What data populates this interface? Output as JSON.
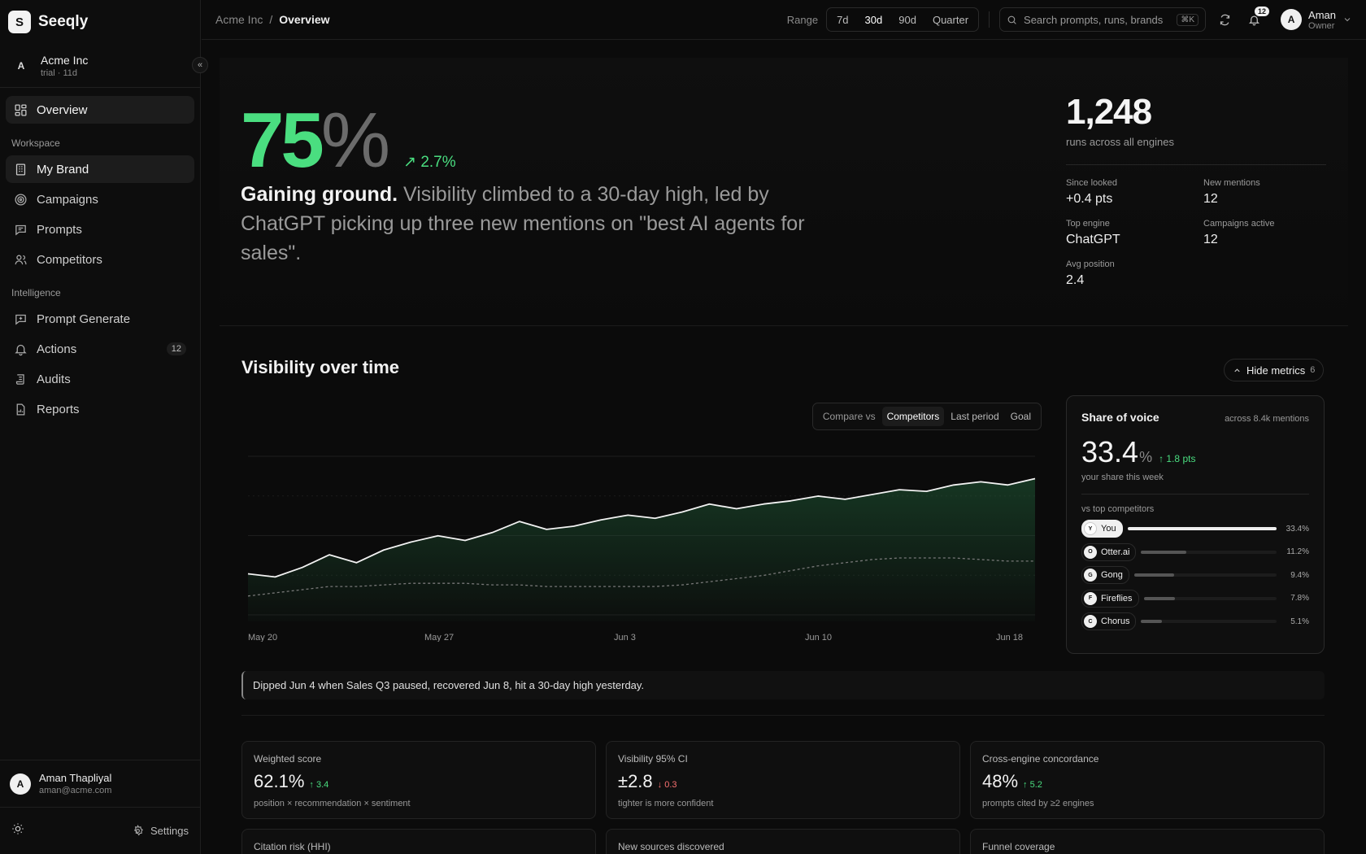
{
  "app": {
    "logo_letter": "S",
    "name": "Seeqly"
  },
  "org": {
    "avatar": "A",
    "name": "Acme Inc",
    "sub": "trial · 11d",
    "collapse_icon": "«"
  },
  "nav": {
    "overview": "Overview",
    "workspace_label": "Workspace",
    "workspace": [
      "My Brand",
      "Campaigns",
      "Prompts",
      "Competitors"
    ],
    "intelligence_label": "Intelligence",
    "intelligence": [
      "Prompt Generate",
      "Actions",
      "Audits",
      "Reports"
    ],
    "actions_badge": "12"
  },
  "user": {
    "avatar": "A",
    "name": "Aman Thapliyal",
    "email": "aman@acme.com"
  },
  "footer": {
    "settings": "Settings"
  },
  "topbar": {
    "crumb_org": "Acme Inc",
    "crumb_sep": "/",
    "crumb_page": "Overview",
    "range_label": "Range",
    "ranges": [
      "7d",
      "30d",
      "90d",
      "Quarter"
    ],
    "active_range": "30d",
    "search_placeholder": "Search prompts, runs, brands",
    "search_kbd": "⌘K",
    "notifications": "12",
    "me_avatar": "A",
    "me_name": "Aman",
    "me_role": "Owner"
  },
  "hero": {
    "score": "75",
    "score_unit": "%",
    "delta": "↗ 2.7%",
    "headline": "Gaining ground.",
    "summary": " Visibility climbed to a 30-day high, led by ChatGPT picking up three new mentions on \"best AI agents for sales\".",
    "runs": "1,248",
    "runs_sub": "runs across all engines",
    "stats": [
      {
        "label": "Since looked",
        "value": "+0.4 pts"
      },
      {
        "label": "New mentions",
        "value": "12"
      },
      {
        "label": "Top engine",
        "value": "ChatGPT"
      },
      {
        "label": "Campaigns active",
        "value": "12"
      },
      {
        "label": "Avg position",
        "value": "2.4"
      }
    ]
  },
  "visibility": {
    "title": "Visibility over time",
    "hide_metrics": "Hide metrics",
    "hide_metrics_count": "6",
    "compare_label": "Compare vs",
    "compare_options": [
      "Competitors",
      "Last period",
      "Goal"
    ],
    "active_compare": "Competitors",
    "note": "Dipped Jun 4 when Sales Q3 paused, recovered Jun 8, hit a 30-day high yesterday."
  },
  "chart_data": {
    "type": "line",
    "x_ticks": [
      "May 20",
      "May 27",
      "Jun 3",
      "Jun 10",
      "Jun 18"
    ],
    "series": [
      {
        "values": [
          30,
          28,
          34,
          42,
          37,
          45,
          50,
          54,
          51,
          56,
          63,
          58,
          60,
          64,
          67,
          65,
          69,
          74,
          71,
          74,
          76,
          79,
          77,
          80,
          83,
          82,
          86,
          88,
          86,
          90
        ]
      },
      {
        "values": [
          16,
          18,
          20,
          22,
          22,
          23,
          24,
          24,
          24,
          23,
          23,
          22,
          22,
          22,
          22,
          22,
          23,
          25,
          27,
          29,
          32,
          35,
          37,
          39,
          40,
          40,
          40,
          39,
          38,
          38
        ]
      }
    ],
    "ylim": [
      0,
      100
    ],
    "grid": true
  },
  "sov": {
    "title": "Share of voice",
    "sub": "across 8.4k mentions",
    "value": "33.4",
    "unit": "%",
    "delta": "↑ 1.8 pts",
    "caption": "your share this week",
    "vs_label": "vs top competitors",
    "competitors": [
      {
        "initial": "Y",
        "name": "You",
        "share": 33.4,
        "label": "33.4%"
      },
      {
        "initial": "O",
        "name": "Otter.ai",
        "share": 11.2,
        "label": "11.2%"
      },
      {
        "initial": "G",
        "name": "Gong",
        "share": 9.4,
        "label": "9.4%"
      },
      {
        "initial": "F",
        "name": "Fireflies",
        "share": 7.8,
        "label": "7.8%"
      },
      {
        "initial": "C",
        "name": "Chorus",
        "share": 5.1,
        "label": "5.1%"
      }
    ]
  },
  "metrics": [
    {
      "label": "Weighted score",
      "value": "62.1%",
      "delta": "↑ 3.4",
      "caption": "position × recommendation × sentiment"
    },
    {
      "label": "Visibility 95% CI",
      "value": "±2.8",
      "delta": "↓ 0.3",
      "caption": "tighter is more confident"
    },
    {
      "label": "Cross-engine concordance",
      "value": "48%",
      "delta": "↑ 5.2",
      "caption": "prompts cited by ≥2 engines"
    },
    {
      "label": "Citation risk (HHI)"
    },
    {
      "label": "New sources discovered"
    },
    {
      "label": "Funnel coverage"
    }
  ],
  "colors": {
    "accent_green": "#4ade80",
    "negative_red": "#f87171",
    "bg": "#0b0b0b"
  }
}
